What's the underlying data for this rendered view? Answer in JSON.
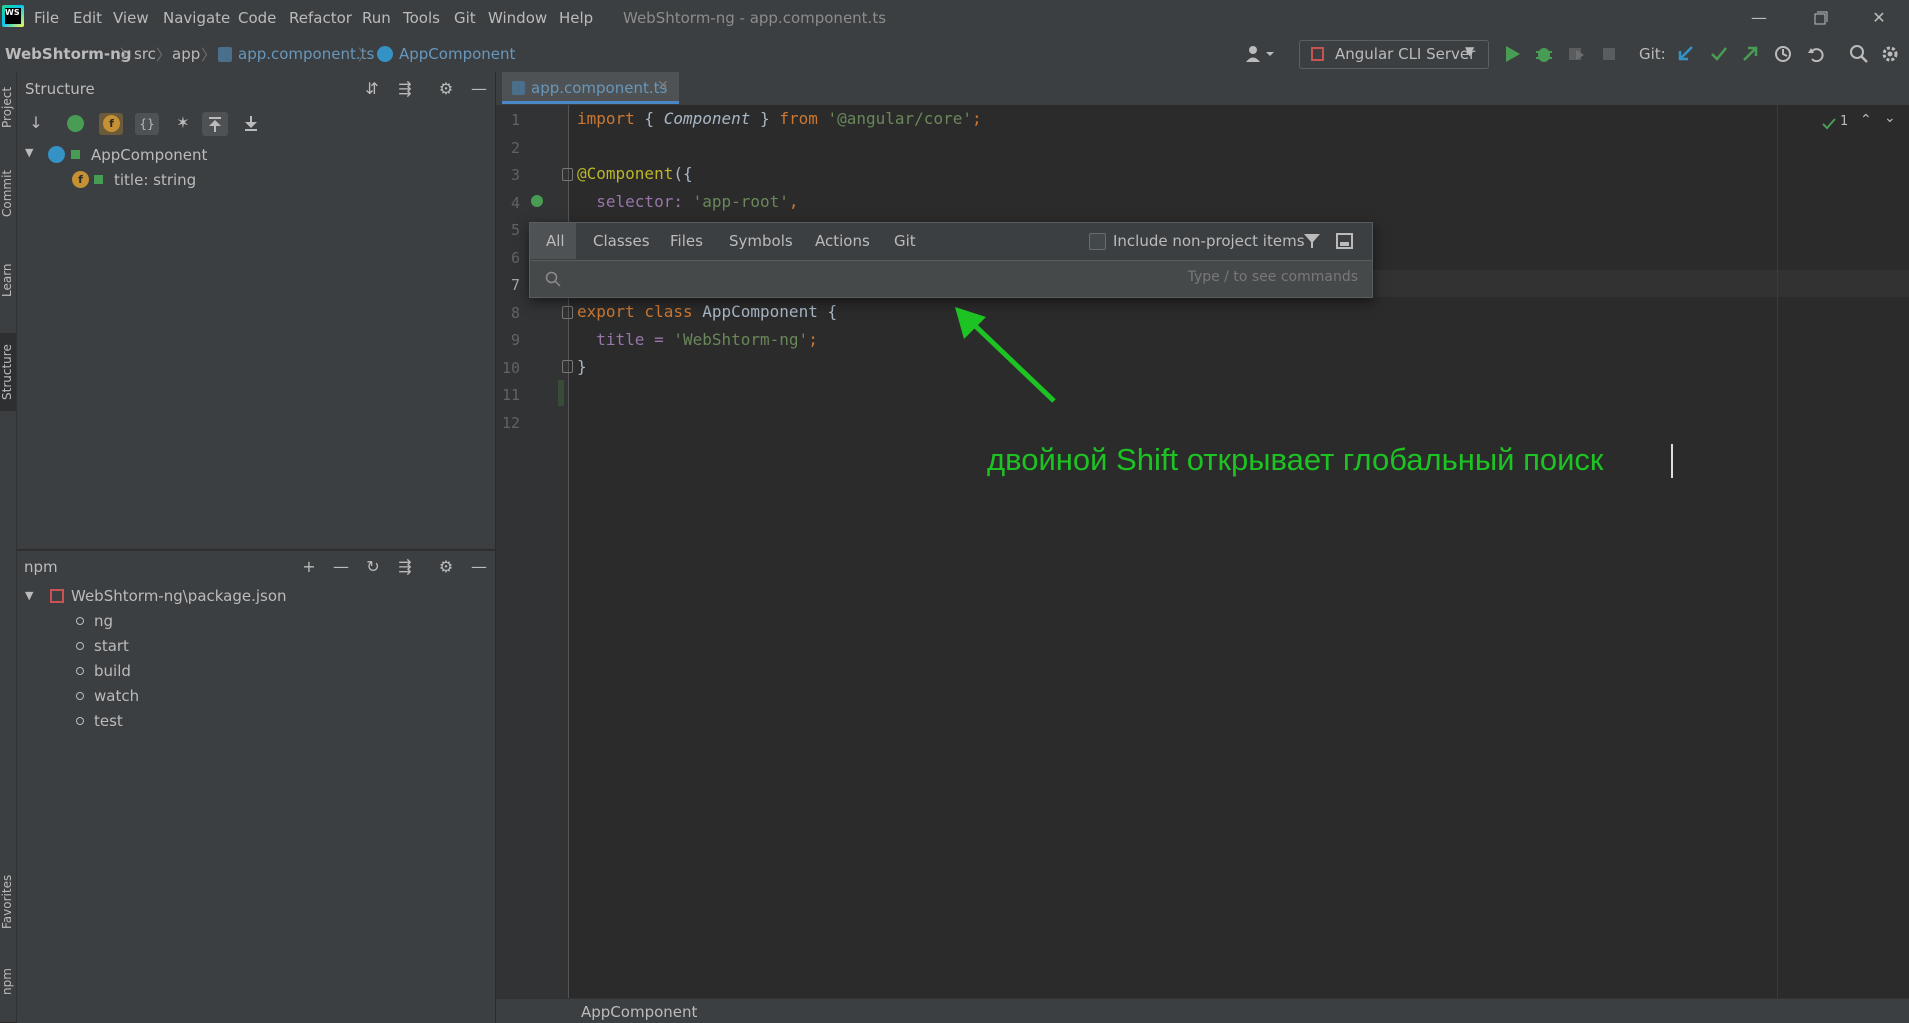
{
  "app": {
    "logo_text": "WS",
    "window_title": "WebShtorm-ng - app.component.ts",
    "menu": [
      "File",
      "Edit",
      "View",
      "Navigate",
      "Code",
      "Refactor",
      "Run",
      "Tools",
      "Git",
      "Window",
      "Help"
    ]
  },
  "navbar": {
    "project": "WebShtorm-ng",
    "crumbs": [
      "src",
      "app",
      "app.component.ts",
      "AppComponent"
    ],
    "run_config": "Angular CLI Server",
    "git_label": "Git:"
  },
  "left_strip": {
    "tabs": [
      "Project",
      "Commit",
      "Learn",
      "Structure",
      "Favorites",
      "npm"
    ]
  },
  "structure": {
    "title": "Structure",
    "tree": [
      {
        "label": "AppComponent"
      },
      {
        "label": "title: string"
      }
    ]
  },
  "npm": {
    "title": "npm",
    "package": "WebShtorm-ng\\package.json",
    "scripts": [
      "ng",
      "start",
      "build",
      "watch",
      "test"
    ]
  },
  "editor": {
    "tab": "app.component.ts",
    "inspection_count": "1",
    "line_numbers": [
      "1",
      "2",
      "3",
      "4",
      "5",
      "6",
      "7",
      "8",
      "9",
      "10",
      "11",
      "12"
    ]
  },
  "code": {
    "l1_import": "import",
    "l1_brace_open": " { ",
    "l1_component": "Component",
    "l1_brace_close": " } ",
    "l1_from": "from",
    "l1_module": " '@angular/core'",
    "l1_semi": ";",
    "l3_decorator": "@Component",
    "l3_rest": "({",
    "l4_key": "selector: ",
    "l4_value": "'app-root'",
    "l4_comma": ",",
    "l8_export": "export",
    "l8_class": " class ",
    "l8_name": "AppComponent {",
    "l9_key": "  title = ",
    "l9_value": "'WebShtorm-ng'",
    "l9_semi": ";",
    "l10_close": "}"
  },
  "search_popup": {
    "tabs": [
      "All",
      "Classes",
      "Files",
      "Symbols",
      "Actions",
      "Git"
    ],
    "include_label": "Include non-project items",
    "placeholder": "Type / to see commands"
  },
  "status": {
    "breadcrumb": "AppComponent"
  },
  "annotation": {
    "text": "двойной Shift открывает глобальный поиск",
    "color": "#1dc223"
  },
  "colors": {
    "accent": "#4a88c7",
    "run_green": "#499c54",
    "git_blue": "#3592c4"
  }
}
